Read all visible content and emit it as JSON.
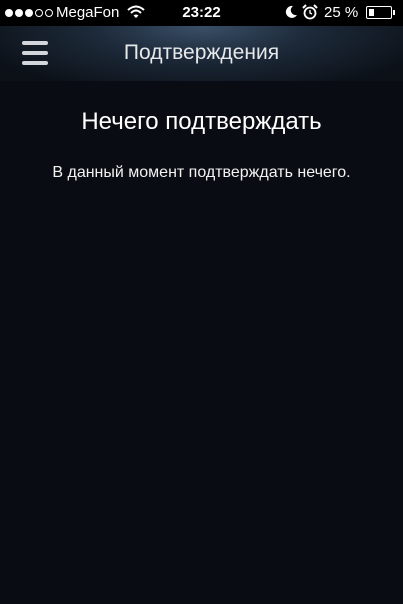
{
  "status_bar": {
    "signal_filled": 3,
    "signal_total": 5,
    "carrier": "MegaFon",
    "time": "23:22",
    "battery_percent": "25 %",
    "battery_level": 0.25,
    "icons": [
      "wifi-icon",
      "moon-icon",
      "alarm-icon",
      "battery-icon"
    ]
  },
  "nav": {
    "menu_icon": "hamburger-menu-icon",
    "title": "Подтверждения"
  },
  "main": {
    "empty_title": "Нечего подтверждать",
    "empty_message": "В данный момент подтверждать нечего."
  },
  "colors": {
    "background": "#090c12",
    "status_bar": "#000000",
    "nav_glow": "#3a5068",
    "text": "#ffffff"
  }
}
